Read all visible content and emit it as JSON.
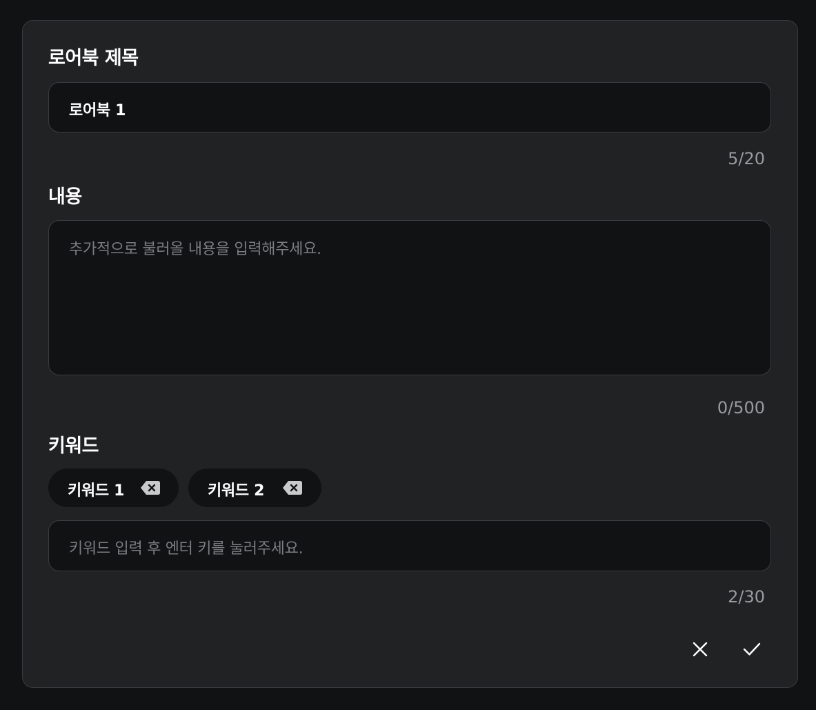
{
  "title_section": {
    "label": "로어북 제목",
    "input_value": "로어북 1",
    "counter": "5/20"
  },
  "content_section": {
    "label": "내용",
    "placeholder": "추가적으로 불러올 내용을 입력해주세요.",
    "counter": "0/500"
  },
  "keyword_section": {
    "label": "키워드",
    "chips": [
      {
        "label": "키워드 1",
        "remove_icon": "backspace-x-icon"
      },
      {
        "label": "키워드 2",
        "remove_icon": "backspace-x-icon"
      }
    ],
    "placeholder": "키워드 입력 후 엔터 키를 눌러주세요.",
    "counter": "2/30"
  },
  "actions": {
    "cancel_icon": "close-icon",
    "confirm_icon": "check-icon"
  },
  "colors": {
    "page_background": "#111214",
    "card_background": "#212224",
    "field_background": "#111214",
    "text_primary": "#ffffff",
    "text_muted": "#7b7c80"
  }
}
